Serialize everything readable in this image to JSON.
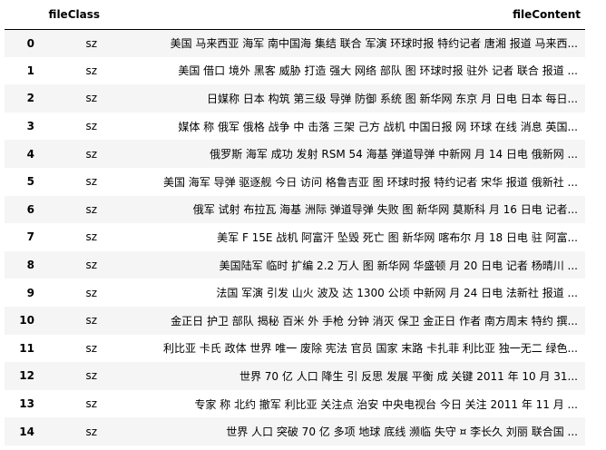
{
  "table": {
    "headers": {
      "index": "",
      "fileClass": "fileClass",
      "fileContent": "fileContent"
    },
    "rows": [
      {
        "index": "0",
        "fileClass": "sz",
        "fileContent": "美国 马来西亚 海军 南中国海 集结 联合 军演 环球时报 特约记者 唐湘 报道 马来西..."
      },
      {
        "index": "1",
        "fileClass": "sz",
        "fileContent": "美国 借口 境外 黑客 威胁 打造 强大 网络 部队 图 环球时报 驻外 记者 联合 报道 ..."
      },
      {
        "index": "2",
        "fileClass": "sz",
        "fileContent": "日媒称 日本 构筑 第三级 导弹 防御 系统 图 新华网 东京 月 日电  日本 每日..."
      },
      {
        "index": "3",
        "fileClass": "sz",
        "fileContent": "媒体 称 俄军 俄格 战争 中 击落 三架 己方 战机 中国日报 网 环球 在线 消息 英国..."
      },
      {
        "index": "4",
        "fileClass": "sz",
        "fileContent": "俄罗斯 海军 成功 发射 RSM 54 海基 弹道导弹 中新网 月 14 日电 俄新网 ..."
      },
      {
        "index": "5",
        "fileClass": "sz",
        "fileContent": "美国 海军 导弹 驱逐舰 今日 访问 格鲁吉亚 图 环球时报 特约记者 宋华 报道 俄新社 ..."
      },
      {
        "index": "6",
        "fileClass": "sz",
        "fileContent": "俄军 试射 布拉瓦 海基 洲际 弹道导弹 失败 图 新华网 莫斯科 月 16 日电 记者..."
      },
      {
        "index": "7",
        "fileClass": "sz",
        "fileContent": "美军 F 15E 战机 阿富汗 坠毁 死亡 图 新华网 喀布尔 月 18 日电 驻 阿富..."
      },
      {
        "index": "8",
        "fileClass": "sz",
        "fileContent": "美国陆军 临时 扩编 2.2 万人 图 新华网 华盛顿 月 20 日电 记者 杨晴川 ..."
      },
      {
        "index": "9",
        "fileClass": "sz",
        "fileContent": "法国 军演 引发 山火 波及 达 1300 公顷 中新网 月 24 日电 法新社 报道 ..."
      },
      {
        "index": "10",
        "fileClass": "sz",
        "fileContent": "金正日 护卫 部队 揭秘 百米 外 手枪 分钟 消灭 保卫 金正日 作者 南方周末 特约 撰..."
      },
      {
        "index": "11",
        "fileClass": "sz",
        "fileContent": "利比亚 卡氏 政体 世界 唯一 废除 宪法 官员 国家 末路 卡扎菲 利比亚 独一无二 绿色..."
      },
      {
        "index": "12",
        "fileClass": "sz",
        "fileContent": "世界 70 亿 人口 降生 引 反思 发展 平衡 成 关键 2011 年 10 月 31..."
      },
      {
        "index": "13",
        "fileClass": "sz",
        "fileContent": "专家 称 北约 撤军 利比亚 关注点 治安 中央电视台 今日 关注 2011 年 11 月 ..."
      },
      {
        "index": "14",
        "fileClass": "sz",
        "fileContent": "世界 人口 突破 70 亿 多项 地球 底线 濒临 失守 ¤ 李长久 刘丽 联合国 ..."
      }
    ]
  }
}
